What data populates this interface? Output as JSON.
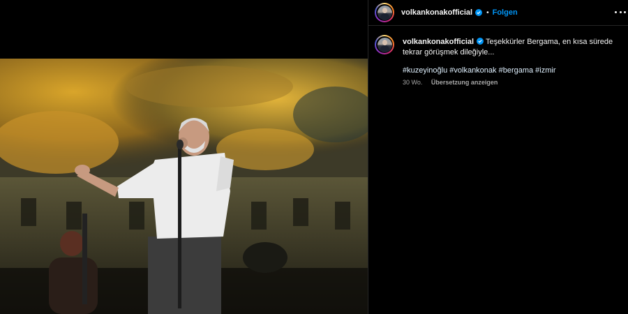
{
  "post": {
    "username": "volkankonakofficial",
    "verified_icon": "verified-badge-icon",
    "follow_label": "Folgen",
    "separator": "•",
    "more_icon": "more-options-icon"
  },
  "caption": {
    "username": "volkankonakofficial",
    "text": "Teşekkürler Bergama, en kısa sürede tekrar görüşmek dileğiyle...",
    "hashtags": "#kuzeyinoğlu #volkankonak #bergama #izmir",
    "time_ago": "30 Wo.",
    "translate_label": "Übersetzung anzeigen"
  },
  "colors": {
    "link_blue": "#0095f6",
    "background": "#000000",
    "secondary_text": "#a8a8a8"
  }
}
